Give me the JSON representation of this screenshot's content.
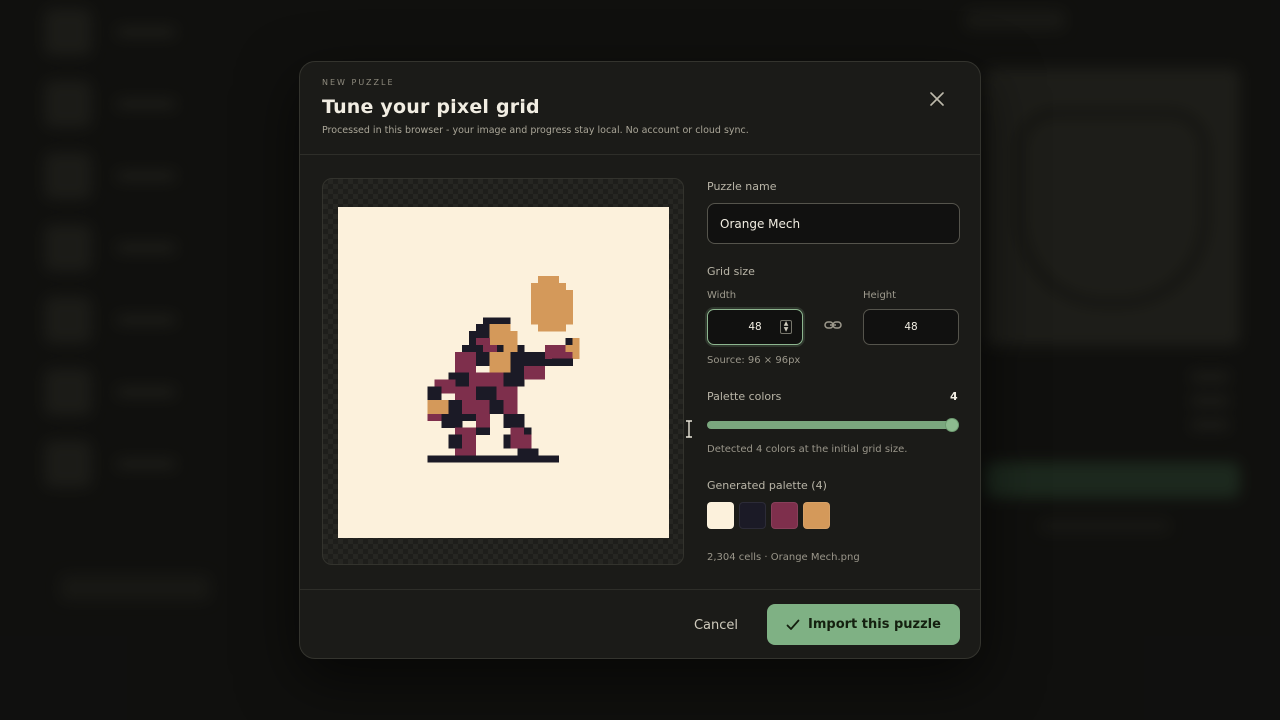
{
  "modal": {
    "eyebrow": "NEW PUZZLE",
    "title": "Tune your pixel grid",
    "subtitle": "Processed in this browser - your image and progress stay local. No account or cloud sync.",
    "close_icon": "close-icon"
  },
  "form": {
    "name_label": "Puzzle name",
    "name_value": "Orange Mech",
    "grid_label": "Grid size",
    "width_label": "Width",
    "width_value": "48",
    "height_label": "Height",
    "height_value": "48",
    "source_hint": "Source: 96 × 96px",
    "palette_label": "Palette colors",
    "palette_value": "4",
    "palette_slider_fraction": 1.0,
    "palette_hint": "Detected 4 colors at the initial grid size.",
    "generated_label": "Generated palette (4)",
    "swatches": [
      "#fcf1dc",
      "#1b1a26",
      "#7e2f4c",
      "#d4995a"
    ],
    "file_info": "2,304 cells · Orange Mech.png"
  },
  "footer": {
    "cancel_label": "Cancel",
    "import_label": "Import this puzzle"
  },
  "colors": {
    "accent": "#7fb184",
    "modal_bg": "#1b1b18",
    "canvas_bg": "#fcf1dc"
  }
}
